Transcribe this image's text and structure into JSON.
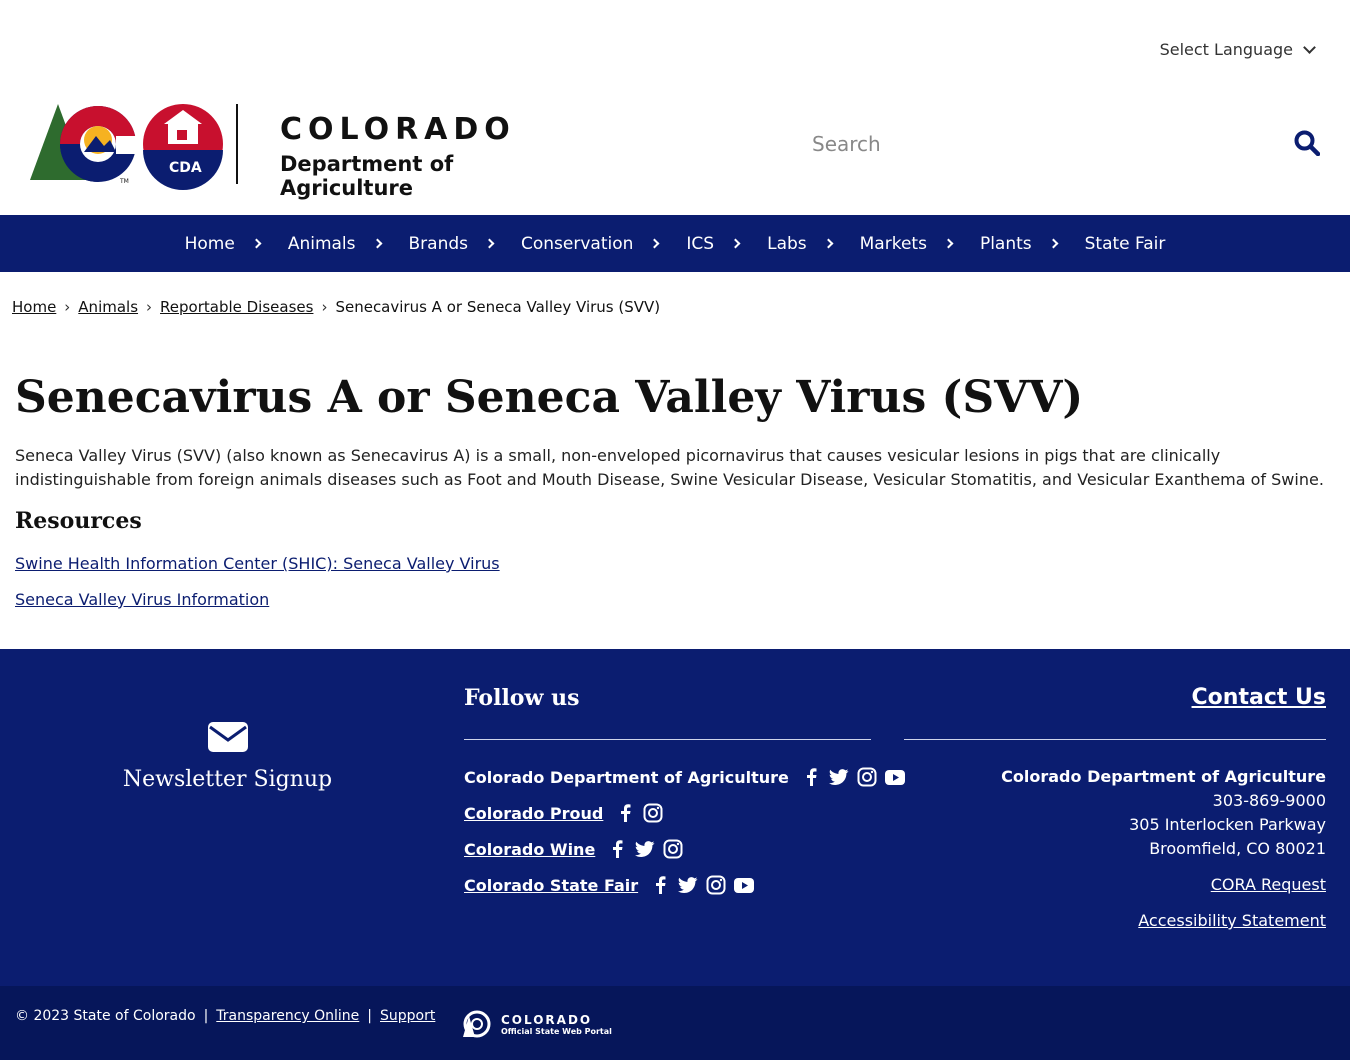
{
  "language": {
    "label": "Select Language",
    "icon": "chevron-down-icon"
  },
  "logo": {
    "line1": "COLORADO",
    "line2": "Department of Agriculture",
    "badge": "CDA",
    "tm": "TM"
  },
  "search": {
    "placeholder": "Search",
    "icon": "search-icon"
  },
  "nav": {
    "items": [
      {
        "label": "Home"
      },
      {
        "label": "Animals"
      },
      {
        "label": "Brands"
      },
      {
        "label": "Conservation"
      },
      {
        "label": "ICS"
      },
      {
        "label": "Labs"
      },
      {
        "label": "Markets"
      },
      {
        "label": "Plants"
      },
      {
        "label": "State Fair"
      }
    ]
  },
  "breadcrumb": {
    "items": [
      "Home",
      "Animals",
      "Reportable Diseases"
    ],
    "current": "Senecavirus A or Seneca Valley Virus (SVV)",
    "separator": "›"
  },
  "page": {
    "title": "Senecavirus A or Seneca Valley Virus (SVV)",
    "intro": "Seneca Valley Virus (SVV) (also known as Senecavirus A) is a small, non-enveloped picornavirus that causes vesicular lesions in pigs that are clinically indistinguishable from foreign animals diseases such as Foot and Mouth Disease, Swine Vesicular Disease, Vesicular Stomatitis, and Vesicular Exanthema of Swine.",
    "resources_heading": "Resources",
    "resources": [
      "Swine Health Information Center (SHIC): Seneca Valley Virus",
      "Seneca Valley Virus Information"
    ]
  },
  "footer": {
    "newsletter": {
      "label": "Newsletter Signup",
      "icon": "envelope-icon"
    },
    "follow": {
      "title": "Follow us",
      "rows": [
        {
          "name": "Colorado Department of Agriculture",
          "icons": [
            "facebook-icon",
            "twitter-icon",
            "instagram-icon",
            "youtube-icon"
          ]
        },
        {
          "name": "Colorado Proud",
          "icons": [
            "facebook-icon",
            "instagram-icon"
          ]
        },
        {
          "name": "Colorado Wine",
          "icons": [
            "facebook-icon",
            "twitter-icon",
            "instagram-icon"
          ]
        },
        {
          "name": "Colorado State Fair",
          "icons": [
            "facebook-icon",
            "twitter-icon",
            "instagram-icon",
            "youtube-icon"
          ]
        }
      ]
    },
    "contact": {
      "title": "Contact Us",
      "org": "Colorado Department of Agriculture",
      "phone": "303-869-9000",
      "street": "305 Interlocken Parkway",
      "city": "Broomfield, CO 80021",
      "cora": "CORA Request",
      "accessibility": "Accessibility Statement"
    },
    "bottom": {
      "copyright": "© 2023 State of Colorado",
      "sep": "|",
      "transparency": "Transparency Online",
      "support": "Support",
      "portal_line1": "COLORADO",
      "portal_line2": "Official State Web Portal"
    }
  },
  "colors": {
    "navy": "#0b1d70",
    "footer_bottom": "#06165a",
    "red": "#c8102e",
    "gold": "#f6b221",
    "green": "#2e6b2e"
  }
}
